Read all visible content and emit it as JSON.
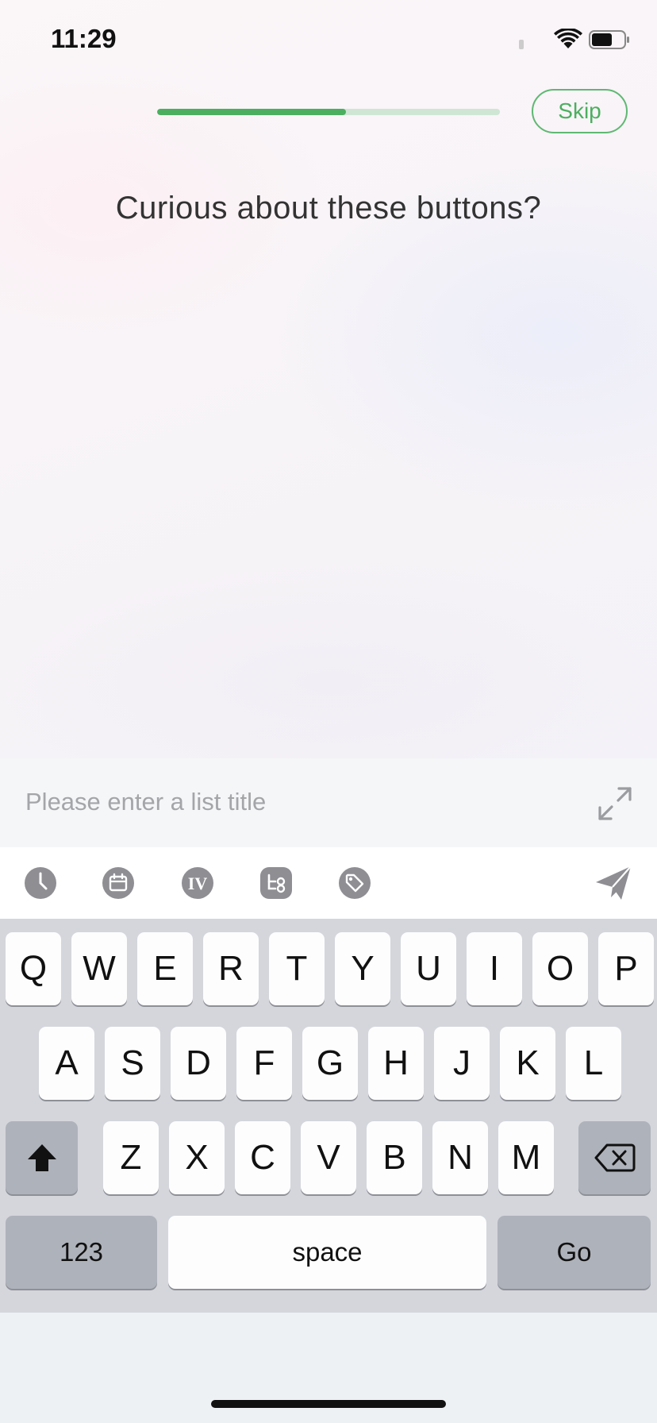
{
  "status_bar": {
    "time": "11:29"
  },
  "onboarding": {
    "progress": 0.55,
    "skip_label": "Skip",
    "headline": "Curious about these buttons?"
  },
  "input": {
    "placeholder": "Please enter a list title",
    "value": ""
  },
  "toolbar": {
    "icons": [
      "clock-icon",
      "calendar-icon",
      "priority-iv-icon",
      "subtask-icon",
      "tag-icon"
    ],
    "priority_glyph": "IV",
    "send_icon": "send-icon"
  },
  "keyboard": {
    "row1": [
      "Q",
      "W",
      "E",
      "R",
      "T",
      "Y",
      "U",
      "I",
      "O",
      "P"
    ],
    "row2": [
      "A",
      "S",
      "D",
      "F",
      "G",
      "H",
      "J",
      "K",
      "L"
    ],
    "row3": [
      "Z",
      "X",
      "C",
      "V",
      "B",
      "N",
      "M"
    ],
    "numbers_label": "123",
    "space_label": "space",
    "go_label": "Go"
  },
  "colors": {
    "accent": "#4caf60",
    "progress_track": "#cfe6d5",
    "icon_grey": "#8e8e93"
  }
}
